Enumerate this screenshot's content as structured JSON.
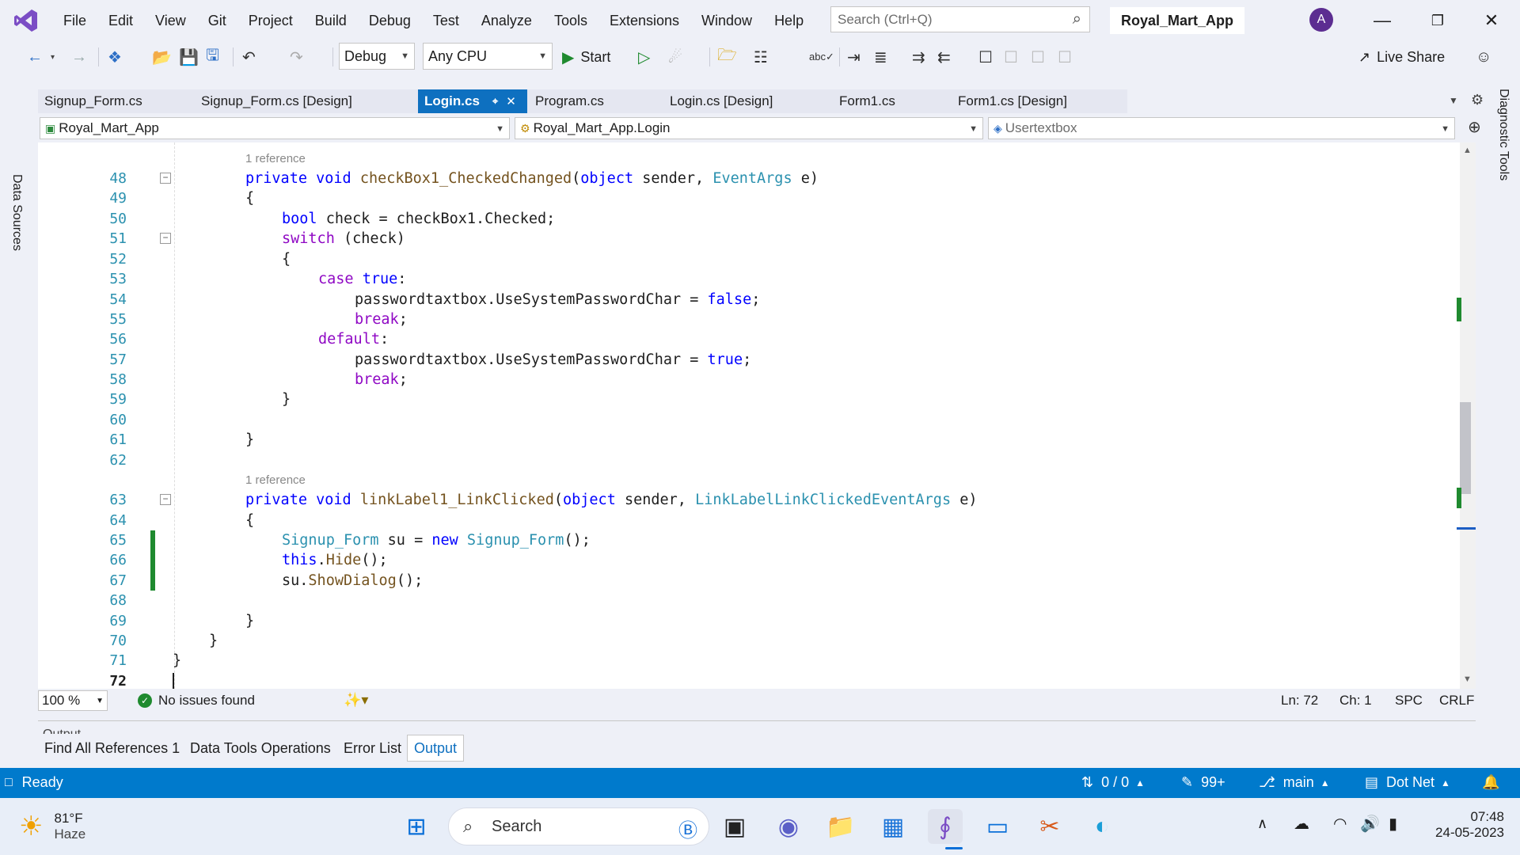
{
  "menubar": {
    "items": [
      "File",
      "Edit",
      "View",
      "Git",
      "Project",
      "Build",
      "Debug",
      "Test",
      "Analyze",
      "Tools",
      "Extensions",
      "Window",
      "Help"
    ],
    "search_placeholder": "Search (Ctrl+Q)",
    "solution_name": "Royal_Mart_App",
    "avatar_initial": "A"
  },
  "toolbar": {
    "configuration": "Debug",
    "platform": "Any CPU",
    "start_label": "Start",
    "live_share_label": "Live Share"
  },
  "side_panels": {
    "left_label": "Data Sources",
    "right_label": "Diagnostic Tools"
  },
  "tabs": [
    {
      "label": "Signup_Form.cs",
      "active": false
    },
    {
      "label": "Signup_Form.cs [Design]",
      "active": false
    },
    {
      "label": "Login.cs",
      "active": true
    },
    {
      "label": "Program.cs",
      "active": false
    },
    {
      "label": "Login.cs [Design]",
      "active": false
    },
    {
      "label": "Form1.cs",
      "active": false
    },
    {
      "label": "Form1.cs [Design]",
      "active": false
    }
  ],
  "navbar": {
    "project": "Royal_Mart_App",
    "class": "Royal_Mart_App.Login",
    "member": "Usertextbox"
  },
  "editor": {
    "reference_label": "1 reference",
    "lines": [
      {
        "n": "48",
        "code": "private void checkBox1_CheckedChanged(object sender, EventArgs e)"
      },
      {
        "n": "49",
        "code": "{"
      },
      {
        "n": "50",
        "code": "bool check = checkBox1.Checked;"
      },
      {
        "n": "51",
        "code": "switch (check)"
      },
      {
        "n": "52",
        "code": "{"
      },
      {
        "n": "53",
        "code": "case true:"
      },
      {
        "n": "54",
        "code": "passwordtaxtbox.UseSystemPasswordChar = false;"
      },
      {
        "n": "55",
        "code": "break;"
      },
      {
        "n": "56",
        "code": "default:"
      },
      {
        "n": "57",
        "code": "passwordtaxtbox.UseSystemPasswordChar = true;"
      },
      {
        "n": "58",
        "code": "break;"
      },
      {
        "n": "59",
        "code": "}"
      },
      {
        "n": "60",
        "code": ""
      },
      {
        "n": "61",
        "code": "}"
      },
      {
        "n": "62",
        "code": ""
      },
      {
        "n": "63",
        "code": "private void linkLabel1_LinkClicked(object sender, LinkLabelLinkClickedEventArgs e)"
      },
      {
        "n": "64",
        "code": "{"
      },
      {
        "n": "65",
        "code": "Signup_Form su = new Signup_Form();"
      },
      {
        "n": "66",
        "code": "this.Hide();"
      },
      {
        "n": "67",
        "code": "su.ShowDialog();"
      },
      {
        "n": "68",
        "code": ""
      },
      {
        "n": "69",
        "code": "}"
      },
      {
        "n": "70",
        "code": "}"
      },
      {
        "n": "71",
        "code": "}"
      },
      {
        "n": "72",
        "code": ""
      }
    ]
  },
  "editor_status": {
    "zoom": "100 %",
    "issues": "No issues found",
    "line": "Ln: 72",
    "char": "Ch: 1",
    "spacing": "SPC",
    "eol": "CRLF"
  },
  "output_panel": {
    "title": "Output"
  },
  "bottom_tabs": [
    "Find All References 1",
    "Data Tools Operations",
    "Error List",
    "Output"
  ],
  "statusbar": {
    "state": "Ready",
    "sync": "0 / 0",
    "edits": "99+",
    "branch": "main",
    "repo": "Dot Net"
  },
  "taskbar": {
    "weather_temp": "81°F",
    "weather_desc": "Haze",
    "search_label": "Search",
    "time": "07:48",
    "date": "24-05-2023"
  }
}
